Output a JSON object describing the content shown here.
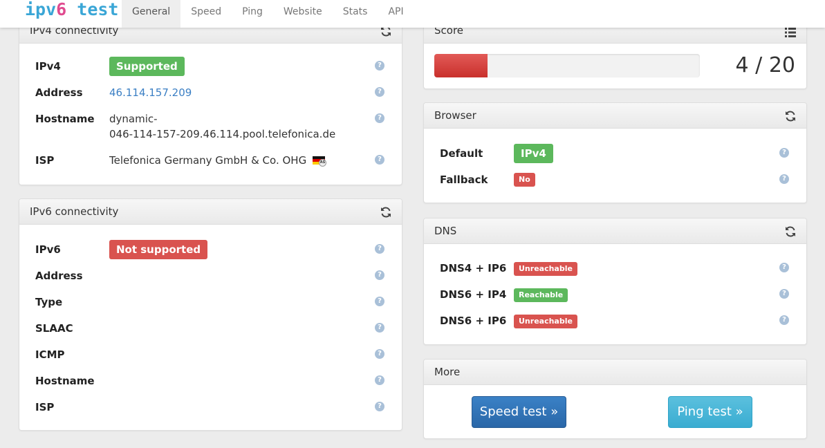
{
  "header": {
    "logo_pre": "ipv",
    "logo_six": "6",
    "logo_post": " test",
    "tabs": [
      "General",
      "Speed",
      "Ping",
      "Website",
      "Stats",
      "API"
    ],
    "active_tab": "General"
  },
  "ipv4": {
    "title": "IPv4 connectivity",
    "rows": {
      "ipv4": {
        "label": "IPv4",
        "badge": "Supported"
      },
      "address": {
        "label": "Address",
        "value": "46.114.157.209"
      },
      "hostname": {
        "label": "Hostname",
        "line1": "dynamic-",
        "line2": "046-114-157-209.46.114.pool.telefonica.de"
      },
      "isp": {
        "label": "ISP",
        "value": "Telefonica Germany GmbH & Co. OHG"
      }
    }
  },
  "ipv6": {
    "title": "IPv6 connectivity",
    "rows": {
      "ipv6": {
        "label": "IPv6",
        "badge": "Not supported"
      },
      "address": {
        "label": "Address"
      },
      "type": {
        "label": "Type"
      },
      "slaac": {
        "label": "SLAAC"
      },
      "icmp": {
        "label": "ICMP"
      },
      "hostname": {
        "label": "Hostname"
      },
      "isp": {
        "label": "ISP"
      }
    }
  },
  "score": {
    "title": "Score",
    "value": "4 / 20",
    "fraction": 0.2
  },
  "browser": {
    "title": "Browser",
    "default": {
      "label": "Default",
      "badge": "IPv4"
    },
    "fallback": {
      "label": "Fallback",
      "badge": "No"
    }
  },
  "dns": {
    "title": "DNS",
    "rows": [
      {
        "label": "DNS4 + IP6",
        "badge": "Unreachable"
      },
      {
        "label": "DNS6 + IP4",
        "badge": "Reachable"
      },
      {
        "label": "DNS6 + IP6",
        "badge": "Unreachable"
      }
    ]
  },
  "more": {
    "title": "More",
    "speed_button": "Speed test »",
    "ping_button": "Ping test »"
  },
  "colors": {
    "success": "#5cb85c",
    "danger": "#d9534f",
    "primary": "#2a67a8",
    "info": "#5bc0de",
    "logo_blue": "#3aa6d6",
    "logo_pink": "#e04a8f"
  },
  "icons": {
    "refresh": "refresh-icon",
    "list": "list-icon",
    "help": "help-icon",
    "flag": "germany-flag-icon"
  }
}
